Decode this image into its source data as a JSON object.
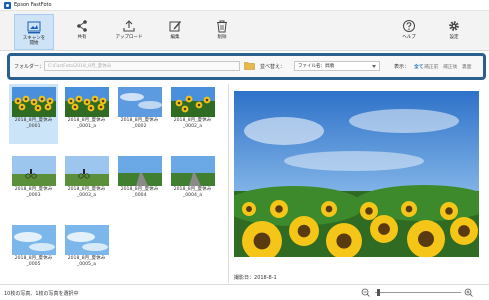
{
  "app": {
    "title": "Epson FastFoto"
  },
  "toolbar": {
    "scan": "スキャンを\n開始",
    "share": "共有",
    "upload": "アップロード",
    "edit": "編集",
    "delete": "削除",
    "help": "ヘルプ",
    "settings": "設定"
  },
  "filter": {
    "folder_label": "フォルダー：",
    "folder_path": "C:\\FastFoto\\2018_8月_夏休み",
    "sort_label": "並べ替え：",
    "sort_value": "ファイル名：昇順",
    "display_label": "表示：",
    "display_options": [
      "全て",
      "補正前",
      "補正後",
      "裏面"
    ],
    "display_selected": "全て"
  },
  "thumbnails": [
    {
      "caption": "2018_8月_夏休み\n_0001",
      "kind": "sunflower",
      "selected": true
    },
    {
      "caption": "2018_8月_夏休み\n_0001_a",
      "kind": "sunflower",
      "selected": false
    },
    {
      "caption": "2018_8月_夏休み\n_0002",
      "kind": "sky",
      "selected": false
    },
    {
      "caption": "2018_8月_夏休み\n_0002_a",
      "kind": "sunflower2",
      "selected": false
    },
    {
      "caption": "2018_8月_夏休み\n_0003",
      "kind": "bike",
      "selected": false
    },
    {
      "caption": "2018_8月_夏休み\n_0003_a",
      "kind": "bike",
      "selected": false
    },
    {
      "caption": "2018_8月_夏休み\n_0004",
      "kind": "road",
      "selected": false
    },
    {
      "caption": "2018_8月_夏休み\n_0004_a",
      "kind": "road",
      "selected": false
    },
    {
      "caption": "2018_8月_夏休み\n_0005",
      "kind": "sky2",
      "selected": false
    },
    {
      "caption": "2018_8月_夏休み\n_0005_a",
      "kind": "sky2",
      "selected": false
    }
  ],
  "preview": {
    "date_label": "撮影日：",
    "date_value": "2018-8-1"
  },
  "status": {
    "text": "10枚の写真、1枚の写真を選択中",
    "zoom_level": 0.02
  },
  "colors": {
    "accent": "#2b5f8e",
    "selection": "#cce4f7",
    "link": "#1e73be"
  }
}
